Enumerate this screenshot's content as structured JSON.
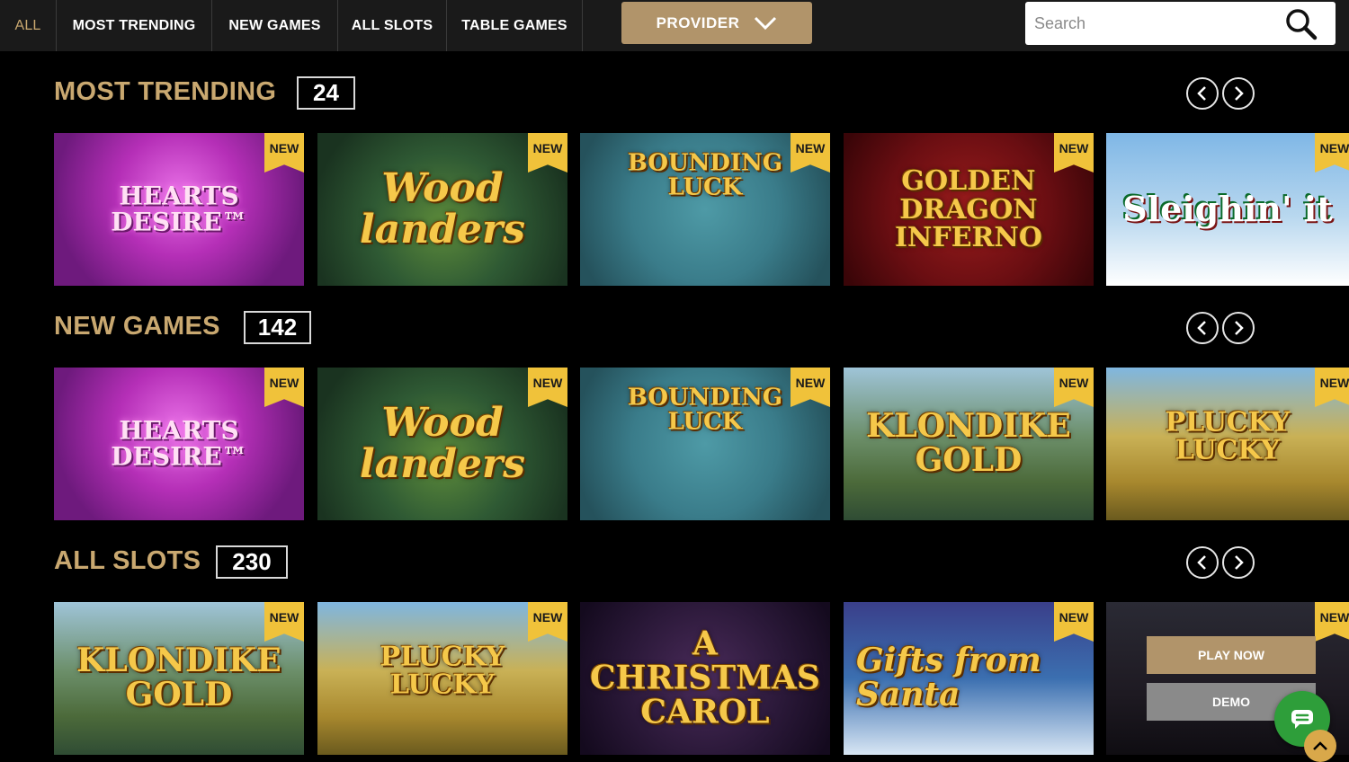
{
  "nav": {
    "tabs": [
      {
        "label": "ALL"
      },
      {
        "label": "MOST TRENDING"
      },
      {
        "label": "NEW GAMES"
      },
      {
        "label": "ALL SLOTS"
      },
      {
        "label": "TABLE GAMES"
      }
    ],
    "provider_label": "PROVIDER",
    "search_placeholder": "Search"
  },
  "sections": [
    {
      "title": "MOST TRENDING",
      "count": "24",
      "games": [
        {
          "title": "HEARTS DESIRE™",
          "badge": "NEW",
          "theme": "hearts"
        },
        {
          "title": "Wood landers",
          "badge": "NEW",
          "theme": "woodland"
        },
        {
          "title": "BOUNDING LUCK",
          "badge": "NEW",
          "theme": "bounding"
        },
        {
          "title": "GOLDEN DRAGON INFERNO",
          "badge": "NEW",
          "theme": "dragon"
        },
        {
          "title": "Sleighin' it",
          "badge": "NEW",
          "theme": "sleigh"
        }
      ]
    },
    {
      "title": "NEW GAMES",
      "count": "142",
      "games": [
        {
          "title": "HEARTS DESIRE™",
          "badge": "NEW",
          "theme": "hearts"
        },
        {
          "title": "Wood landers",
          "badge": "NEW",
          "theme": "woodland"
        },
        {
          "title": "BOUNDING LUCK",
          "badge": "NEW",
          "theme": "bounding"
        },
        {
          "title": "KLONDIKE GOLD",
          "badge": "NEW",
          "theme": "klondike"
        },
        {
          "title": "PLUCKY LUCKY",
          "badge": "NEW",
          "theme": "plucky"
        }
      ]
    },
    {
      "title": "ALL SLOTS",
      "count": "230",
      "games": [
        {
          "title": "KLONDIKE GOLD",
          "badge": "NEW",
          "theme": "klondike"
        },
        {
          "title": "PLUCKY LUCKY",
          "badge": "NEW",
          "theme": "plucky"
        },
        {
          "title": "A CHRISTMAS CAROL",
          "badge": "",
          "theme": "carol"
        },
        {
          "title": "Gifts from Santa",
          "badge": "NEW",
          "theme": "santa"
        },
        {
          "title": "",
          "badge": "NEW",
          "theme": "dim"
        }
      ]
    }
  ],
  "hover": {
    "play_label": "PLAY NOW",
    "demo_label": "DEMO"
  },
  "colors": {
    "gold_accent": "#c9a870",
    "provider_button": "#b1946a",
    "badge_yellow": "#f0c23a",
    "chat_green": "#2e9e3a"
  },
  "icons": {
    "search": "search-icon",
    "provider_dropdown": "chevron-down-icon",
    "prev": "chevron-left-icon",
    "next": "chevron-right-icon",
    "chat": "chat-icon",
    "scroll_top": "chevron-up-icon"
  }
}
